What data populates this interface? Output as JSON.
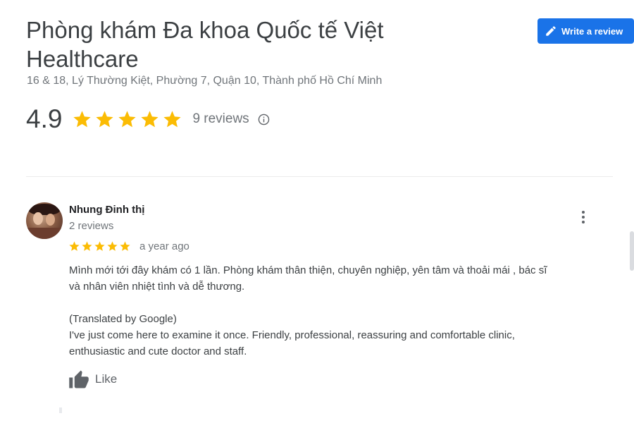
{
  "place": {
    "title": "Phòng khám Đa khoa Quốc tế Việt Healthcare",
    "address": "16 & 18, Lý Thường Kiệt, Phường 7, Quận 10, Thành phố Hồ Chí Minh",
    "rating": "4.9",
    "stars": 5,
    "review_count": "9 reviews",
    "star_color": "#fbbc04"
  },
  "actions": {
    "write_review_label": "Write a review",
    "write_review_icon": "pencil-icon",
    "accent_color": "#1a73e8"
  },
  "review": {
    "author": "Nhung Đinh thị",
    "author_meta": "2 reviews",
    "stars": 5,
    "time": "a year ago",
    "text_original_line1": "Mình mới tới đây khám có 1 lần. Phòng khám thân thiện, chuyên nghiệp, yên tâm và thoải mái , bác sĩ",
    "text_original_line2": "và nhân viên nhiệt tình và dễ thương.",
    "translated_label": "(Translated by Google)",
    "text_translated_line1": "I've just come here to examine it once. Friendly, professional, reassuring and comfortable clinic,",
    "text_translated_line2": "enthusiastic and cute doctor and staff.",
    "like_label": "Like"
  }
}
